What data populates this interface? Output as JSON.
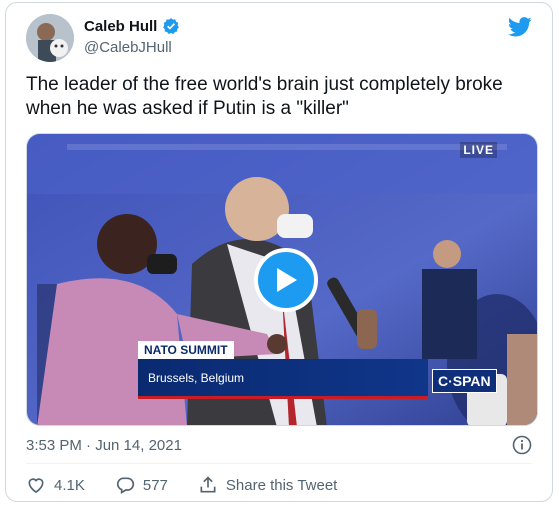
{
  "author": {
    "name": "Caleb Hull",
    "handle": "@CalebJHull",
    "verified": true
  },
  "tweet": {
    "text": "The leader of the free world's brain just completely broke when he was asked if Putin is a \"killer\""
  },
  "media": {
    "live_label": "LIVE",
    "lower_third_title": "NATO SUMMIT",
    "lower_third_location": "Brussels, Belgium",
    "network_logo": "C·SPAN"
  },
  "meta": {
    "timestamp": "3:53 PM · Jun 14, 2021"
  },
  "actions": {
    "likes": "4.1K",
    "replies": "577",
    "share_label": "Share this Tweet"
  },
  "colors": {
    "brand": "#1d9bf0",
    "text": "#0f1419",
    "secondary": "#536471",
    "border": "#cfd9de"
  },
  "icons": {
    "logo": "twitter-bird-icon",
    "verified": "verified-badge-icon",
    "info": "info-icon",
    "like": "heart-icon",
    "reply": "reply-icon",
    "share": "share-icon",
    "play": "play-icon"
  }
}
